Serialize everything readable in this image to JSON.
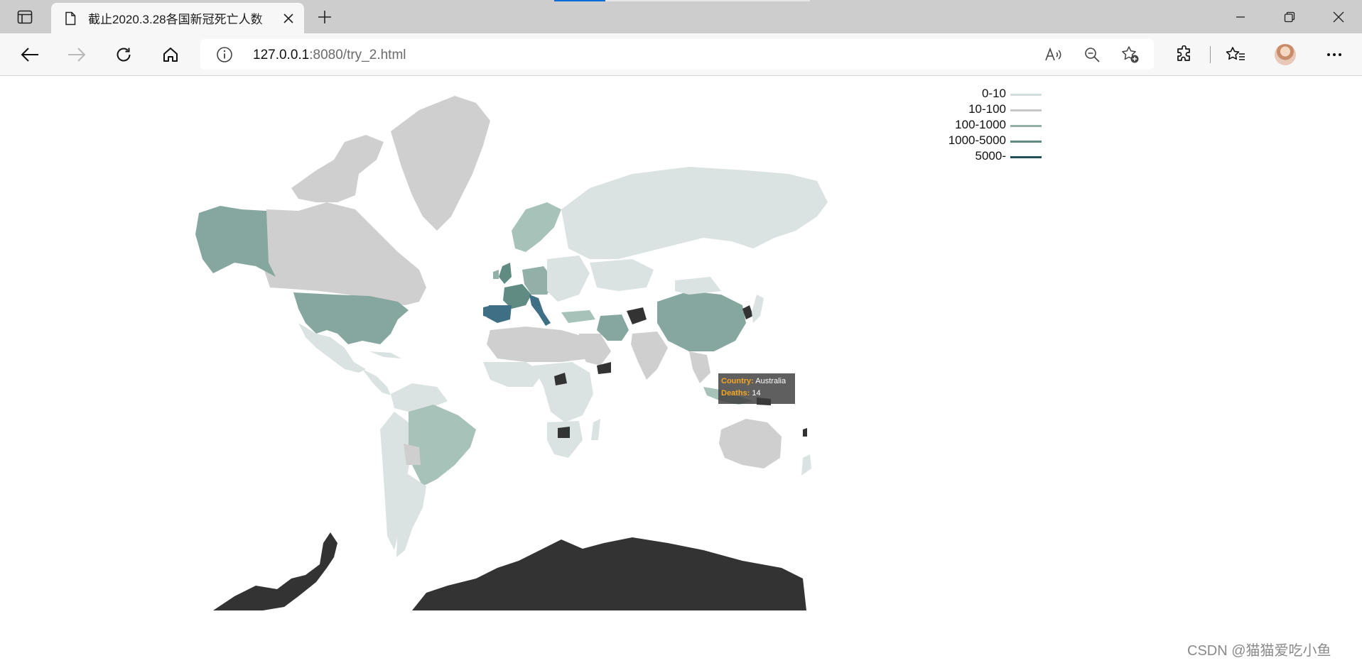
{
  "browser": {
    "tab_title": "截止2020.3.28各国新冠死亡人数",
    "url_host": "127.0.0.1",
    "url_rest": ":8080/try_2.html"
  },
  "map": {
    "legend": [
      {
        "label": "0-10",
        "color": "#d3dddd"
      },
      {
        "label": "10-100",
        "color": "#c8c8c8"
      },
      {
        "label": "100-1000",
        "color": "#92b0a8"
      },
      {
        "label": "1000-5000",
        "color": "#5f8b82"
      },
      {
        "label": "5000-",
        "color": "#1f4e57"
      }
    ],
    "colors": {
      "land_light": "#dbe2e2",
      "land_gray": "#cfcfcf",
      "mid_green": "#86a79f",
      "pale_green": "#a7c2b8",
      "dark_blue": "#3f6f85",
      "no_data": "#333333"
    },
    "tooltip": {
      "country_key": "Country:",
      "country_value": "Australia",
      "deaths_key": "Deaths:",
      "deaths_value": "14"
    }
  },
  "watermark": "CSDN @猫猫爱吃小鱼"
}
